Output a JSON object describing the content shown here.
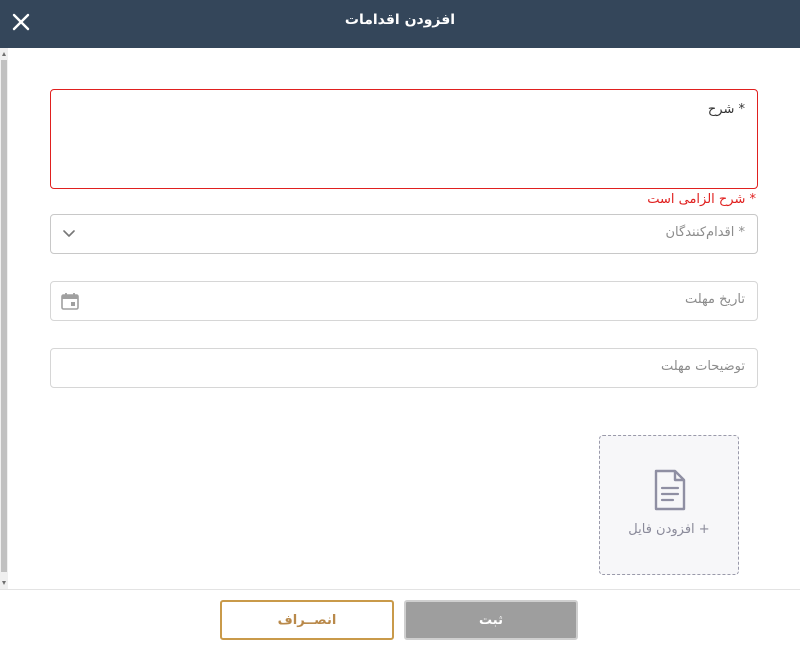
{
  "dialog": {
    "title": "افزودن اقدامات"
  },
  "form": {
    "description": {
      "label": "* شرح",
      "error": "* شرح الزامی است"
    },
    "actors": {
      "placeholder": "* اقدام‌کنندگان"
    },
    "deadline_date": {
      "placeholder": "تاریخ مهلت"
    },
    "deadline_notes": {
      "placeholder": "توضیحات مهلت"
    },
    "upload": {
      "label": "+ افزودن فایل"
    }
  },
  "footer": {
    "submit_label": "ثبت",
    "cancel_label": "انصــراف"
  },
  "icons": {
    "close": "close-icon",
    "chevron": "chevron-down-icon",
    "calendar": "calendar-icon",
    "file": "file-icon"
  },
  "colors": {
    "header_bg": "#34465a",
    "error": "#e0201f",
    "cancel_accent": "#c99a4a",
    "submit_bg": "#9e9e9e"
  }
}
